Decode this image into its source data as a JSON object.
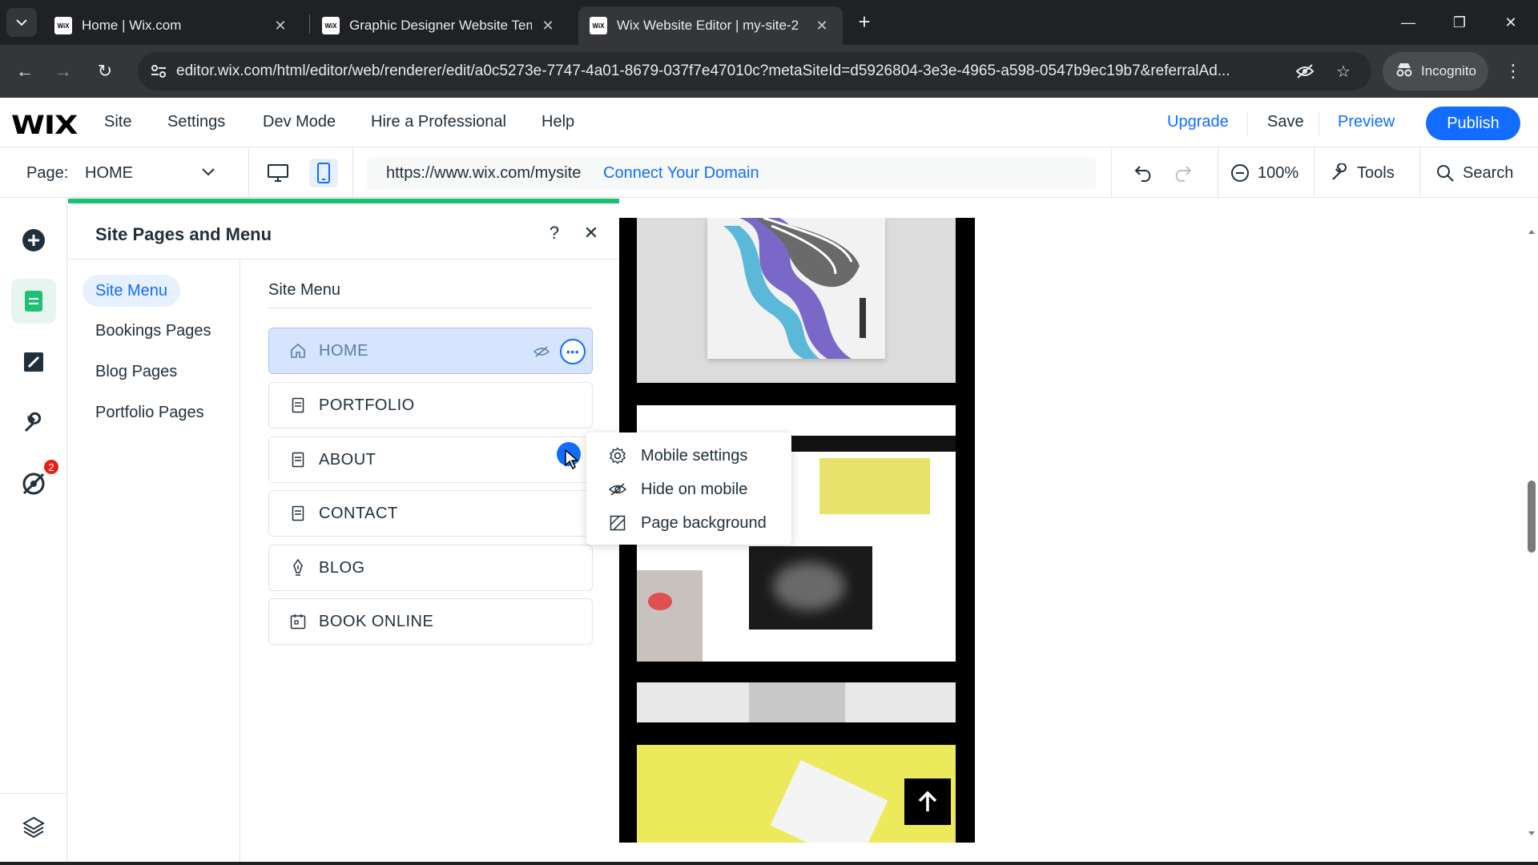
{
  "browser": {
    "tabs": [
      {
        "title": "Home | Wix.com",
        "favicon": "WiX",
        "active": false
      },
      {
        "title": "Graphic Designer Website Temp",
        "favicon": "WiX",
        "active": false
      },
      {
        "title": "Wix Website Editor | my-site-2",
        "favicon": "WiX",
        "active": true
      }
    ],
    "url": "editor.wix.com/html/editor/web/renderer/edit/a0c5273e-7747-4a01-8679-037f7e47010c?metaSiteId=d5926804-3e3e-4965-a598-0547b9ec19b7&referralAd...",
    "incognito_label": "Incognito"
  },
  "wix_top": {
    "logo": "WIX",
    "menu": [
      "Site",
      "Settings",
      "Dev Mode",
      "Hire a Professional",
      "Help"
    ],
    "upgrade": "Upgrade",
    "save": "Save",
    "preview": "Preview",
    "publish": "Publish"
  },
  "pagebar": {
    "page_label": "Page:",
    "page_value": "HOME",
    "site_url": "https://www.wix.com/mysite",
    "connect_domain": "Connect Your Domain",
    "zoom": "100%",
    "tools": "Tools",
    "search": "Search"
  },
  "rail": {
    "notification_count": "2"
  },
  "panel": {
    "title": "Site Pages and Menu",
    "help": "?",
    "nav": [
      "Site Menu",
      "Bookings Pages",
      "Blog Pages",
      "Portfolio Pages"
    ],
    "column_title": "Site Menu",
    "pages": [
      {
        "label": "HOME",
        "icon": "home-icon"
      },
      {
        "label": "PORTFOLIO",
        "icon": "page-icon"
      },
      {
        "label": "ABOUT",
        "icon": "page-icon"
      },
      {
        "label": "CONTACT",
        "icon": "page-icon"
      },
      {
        "label": "BLOG",
        "icon": "pen-icon"
      },
      {
        "label": "BOOK ONLINE",
        "icon": "calendar-icon"
      }
    ]
  },
  "context_menu": {
    "items": [
      "Mobile settings",
      "Hide on mobile",
      "Page background"
    ]
  },
  "colors": {
    "accent": "#116dff",
    "progress": "#20c073",
    "badge": "#e62214"
  }
}
